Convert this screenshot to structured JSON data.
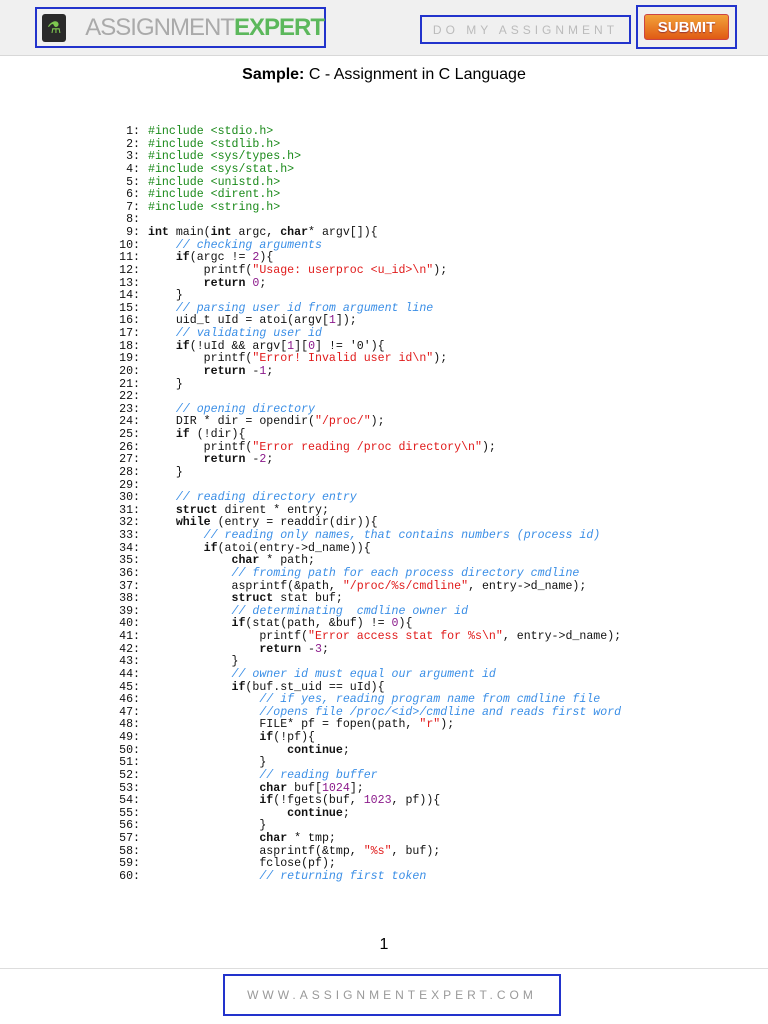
{
  "header": {
    "logo": {
      "icon": "microscope-icon",
      "text_light": "ASSIGNMENT",
      "text_bold": "EXPERT"
    },
    "do_my_assignment": "DO MY ASSIGNMENT",
    "submit": "SUBMIT"
  },
  "title": {
    "prefix": "Sample:",
    "text": " C - Assignment in C Language"
  },
  "code": [
    {
      "n": "1:",
      "i": 0,
      "t": [
        [
          "p",
          "#include <stdio.h>"
        ]
      ]
    },
    {
      "n": "2:",
      "i": 0,
      "t": [
        [
          "p",
          "#include <stdlib.h>"
        ]
      ]
    },
    {
      "n": "3:",
      "i": 0,
      "t": [
        [
          "p",
          "#include <sys/types.h>"
        ]
      ]
    },
    {
      "n": "4:",
      "i": 0,
      "t": [
        [
          "p",
          "#include <sys/stat.h>"
        ]
      ]
    },
    {
      "n": "5:",
      "i": 0,
      "t": [
        [
          "p",
          "#include <unistd.h>"
        ]
      ]
    },
    {
      "n": "6:",
      "i": 0,
      "t": [
        [
          "p",
          "#include <dirent.h>"
        ]
      ]
    },
    {
      "n": "7:",
      "i": 0,
      "t": [
        [
          "p",
          "#include <string.h>"
        ]
      ]
    },
    {
      "n": "8:",
      "i": 0,
      "t": []
    },
    {
      "n": "9:",
      "i": 0,
      "t": [
        [
          "k",
          "int"
        ],
        [
          "t",
          " main("
        ],
        [
          "k",
          "int"
        ],
        [
          "t",
          " argc, "
        ],
        [
          "k",
          "char"
        ],
        [
          "t",
          "* argv[]){"
        ]
      ]
    },
    {
      "n": "10:",
      "i": 1,
      "t": [
        [
          "c",
          "// checking arguments"
        ]
      ]
    },
    {
      "n": "11:",
      "i": 1,
      "t": [
        [
          "k",
          "if"
        ],
        [
          "t",
          "(argc != "
        ],
        [
          "n",
          "2"
        ],
        [
          "t",
          "){"
        ]
      ]
    },
    {
      "n": "12:",
      "i": 2,
      "t": [
        [
          "t",
          "printf("
        ],
        [
          "s",
          "\"Usage: userproc <u_id>\\n\""
        ],
        [
          "t",
          ");"
        ]
      ]
    },
    {
      "n": "13:",
      "i": 2,
      "t": [
        [
          "k",
          "return"
        ],
        [
          "t",
          " "
        ],
        [
          "n",
          "0"
        ],
        [
          "t",
          ";"
        ]
      ]
    },
    {
      "n": "14:",
      "i": 1,
      "t": [
        [
          "t",
          "}"
        ]
      ]
    },
    {
      "n": "15:",
      "i": 1,
      "t": [
        [
          "c",
          "// parsing user id from argument line"
        ]
      ]
    },
    {
      "n": "16:",
      "i": 1,
      "t": [
        [
          "t",
          "uid_t uId = atoi(argv["
        ],
        [
          "n",
          "1"
        ],
        [
          "t",
          "]);"
        ]
      ]
    },
    {
      "n": "17:",
      "i": 1,
      "t": [
        [
          "c",
          "// validating user id"
        ]
      ]
    },
    {
      "n": "18:",
      "i": 1,
      "t": [
        [
          "k",
          "if"
        ],
        [
          "t",
          "(!uId && argv["
        ],
        [
          "n",
          "1"
        ],
        [
          "t",
          "]["
        ],
        [
          "n",
          "0"
        ],
        [
          "t",
          "] != '0'){"
        ]
      ]
    },
    {
      "n": "19:",
      "i": 2,
      "t": [
        [
          "t",
          "printf("
        ],
        [
          "s",
          "\"Error! Invalid user id\\n\""
        ],
        [
          "t",
          ");"
        ]
      ]
    },
    {
      "n": "20:",
      "i": 2,
      "t": [
        [
          "k",
          "return"
        ],
        [
          "t",
          " -"
        ],
        [
          "n",
          "1"
        ],
        [
          "t",
          ";"
        ]
      ]
    },
    {
      "n": "21:",
      "i": 1,
      "t": [
        [
          "t",
          "}"
        ]
      ]
    },
    {
      "n": "22:",
      "i": 0,
      "t": []
    },
    {
      "n": "23:",
      "i": 1,
      "t": [
        [
          "c",
          "// opening directory"
        ]
      ]
    },
    {
      "n": "24:",
      "i": 1,
      "t": [
        [
          "t",
          "DIR * dir = opendir("
        ],
        [
          "s",
          "\"/proc/\""
        ],
        [
          "t",
          ");"
        ]
      ]
    },
    {
      "n": "25:",
      "i": 1,
      "t": [
        [
          "k",
          "if"
        ],
        [
          "t",
          " (!dir){"
        ]
      ]
    },
    {
      "n": "26:",
      "i": 2,
      "t": [
        [
          "t",
          "printf("
        ],
        [
          "s",
          "\"Error reading /proc directory\\n\""
        ],
        [
          "t",
          ");"
        ]
      ]
    },
    {
      "n": "27:",
      "i": 2,
      "t": [
        [
          "k",
          "return"
        ],
        [
          "t",
          " -"
        ],
        [
          "n",
          "2"
        ],
        [
          "t",
          ";"
        ]
      ]
    },
    {
      "n": "28:",
      "i": 1,
      "t": [
        [
          "t",
          "}"
        ]
      ]
    },
    {
      "n": "29:",
      "i": 0,
      "t": []
    },
    {
      "n": "30:",
      "i": 1,
      "t": [
        [
          "c",
          "// reading directory entry"
        ]
      ]
    },
    {
      "n": "31:",
      "i": 1,
      "t": [
        [
          "k",
          "struct"
        ],
        [
          "t",
          " dirent * entry;"
        ]
      ]
    },
    {
      "n": "32:",
      "i": 1,
      "t": [
        [
          "k",
          "while"
        ],
        [
          "t",
          " (entry = readdir(dir)){"
        ]
      ]
    },
    {
      "n": "33:",
      "i": 2,
      "t": [
        [
          "c",
          "// reading only names, that contains numbers (process id)"
        ]
      ]
    },
    {
      "n": "34:",
      "i": 2,
      "t": [
        [
          "k",
          "if"
        ],
        [
          "t",
          "(atoi(entry->d_name)){"
        ]
      ]
    },
    {
      "n": "35:",
      "i": 3,
      "t": [
        [
          "k",
          "char"
        ],
        [
          "t",
          " * path;"
        ]
      ]
    },
    {
      "n": "36:",
      "i": 3,
      "t": [
        [
          "c",
          "// froming path for each process directory cmdline"
        ]
      ]
    },
    {
      "n": "37:",
      "i": 3,
      "t": [
        [
          "t",
          "asprintf(&path, "
        ],
        [
          "s",
          "\"/proc/%s/cmdline\""
        ],
        [
          "t",
          ", entry->d_name);"
        ]
      ]
    },
    {
      "n": "38:",
      "i": 3,
      "t": [
        [
          "k",
          "struct"
        ],
        [
          "t",
          " stat buf;"
        ]
      ]
    },
    {
      "n": "39:",
      "i": 3,
      "t": [
        [
          "c",
          "// determinating  cmdline owner id"
        ]
      ]
    },
    {
      "n": "40:",
      "i": 3,
      "t": [
        [
          "k",
          "if"
        ],
        [
          "t",
          "(stat(path, &buf) != "
        ],
        [
          "n",
          "0"
        ],
        [
          "t",
          "){"
        ]
      ]
    },
    {
      "n": "41:",
      "i": 4,
      "t": [
        [
          "t",
          "printf("
        ],
        [
          "s",
          "\"Error access stat for %s\\n\""
        ],
        [
          "t",
          ", entry->d_name);"
        ]
      ]
    },
    {
      "n": "42:",
      "i": 4,
      "t": [
        [
          "k",
          "return"
        ],
        [
          "t",
          " -"
        ],
        [
          "n",
          "3"
        ],
        [
          "t",
          ";"
        ]
      ]
    },
    {
      "n": "43:",
      "i": 3,
      "t": [
        [
          "t",
          "}"
        ]
      ]
    },
    {
      "n": "44:",
      "i": 3,
      "t": [
        [
          "c",
          "// owner id must equal our argument id"
        ]
      ]
    },
    {
      "n": "45:",
      "i": 3,
      "t": [
        [
          "k",
          "if"
        ],
        [
          "t",
          "(buf.st_uid == uId){"
        ]
      ]
    },
    {
      "n": "46:",
      "i": 4,
      "t": [
        [
          "c",
          "// if yes, reading program name from cmdline file"
        ]
      ]
    },
    {
      "n": "47:",
      "i": 4,
      "t": [
        [
          "c",
          "//opens file /proc/<id>/cmdline and reads first word"
        ]
      ]
    },
    {
      "n": "48:",
      "i": 4,
      "t": [
        [
          "t",
          "FILE* pf = fopen(path, "
        ],
        [
          "s",
          "\"r\""
        ],
        [
          "t",
          ");"
        ]
      ]
    },
    {
      "n": "49:",
      "i": 4,
      "t": [
        [
          "k",
          "if"
        ],
        [
          "t",
          "(!pf){"
        ]
      ]
    },
    {
      "n": "50:",
      "i": 5,
      "t": [
        [
          "k",
          "continue"
        ],
        [
          "t",
          ";"
        ]
      ]
    },
    {
      "n": "51:",
      "i": 4,
      "t": [
        [
          "t",
          "}"
        ]
      ]
    },
    {
      "n": "52:",
      "i": 4,
      "t": [
        [
          "c",
          "// reading buffer"
        ]
      ]
    },
    {
      "n": "53:",
      "i": 4,
      "t": [
        [
          "k",
          "char"
        ],
        [
          "t",
          " buf["
        ],
        [
          "n",
          "1024"
        ],
        [
          "t",
          "];"
        ]
      ]
    },
    {
      "n": "54:",
      "i": 4,
      "t": [
        [
          "k",
          "if"
        ],
        [
          "t",
          "(!fgets(buf, "
        ],
        [
          "n",
          "1023"
        ],
        [
          "t",
          ", pf)){"
        ]
      ]
    },
    {
      "n": "55:",
      "i": 5,
      "t": [
        [
          "k",
          "continue"
        ],
        [
          "t",
          ";"
        ]
      ]
    },
    {
      "n": "56:",
      "i": 4,
      "t": [
        [
          "t",
          "}"
        ]
      ]
    },
    {
      "n": "57:",
      "i": 4,
      "t": [
        [
          "k",
          "char"
        ],
        [
          "t",
          " * tmp;"
        ]
      ]
    },
    {
      "n": "58:",
      "i": 4,
      "t": [
        [
          "t",
          "asprintf(&tmp, "
        ],
        [
          "s",
          "\"%s\""
        ],
        [
          "t",
          ", buf);"
        ]
      ]
    },
    {
      "n": "59:",
      "i": 4,
      "t": [
        [
          "t",
          "fclose(pf);"
        ]
      ]
    },
    {
      "n": "60:",
      "i": 4,
      "t": [
        [
          "c",
          "// returning first token"
        ]
      ]
    }
  ],
  "page_number": "1",
  "footer": {
    "url": "WWW.ASSIGNMENTEXPERT.COM"
  }
}
